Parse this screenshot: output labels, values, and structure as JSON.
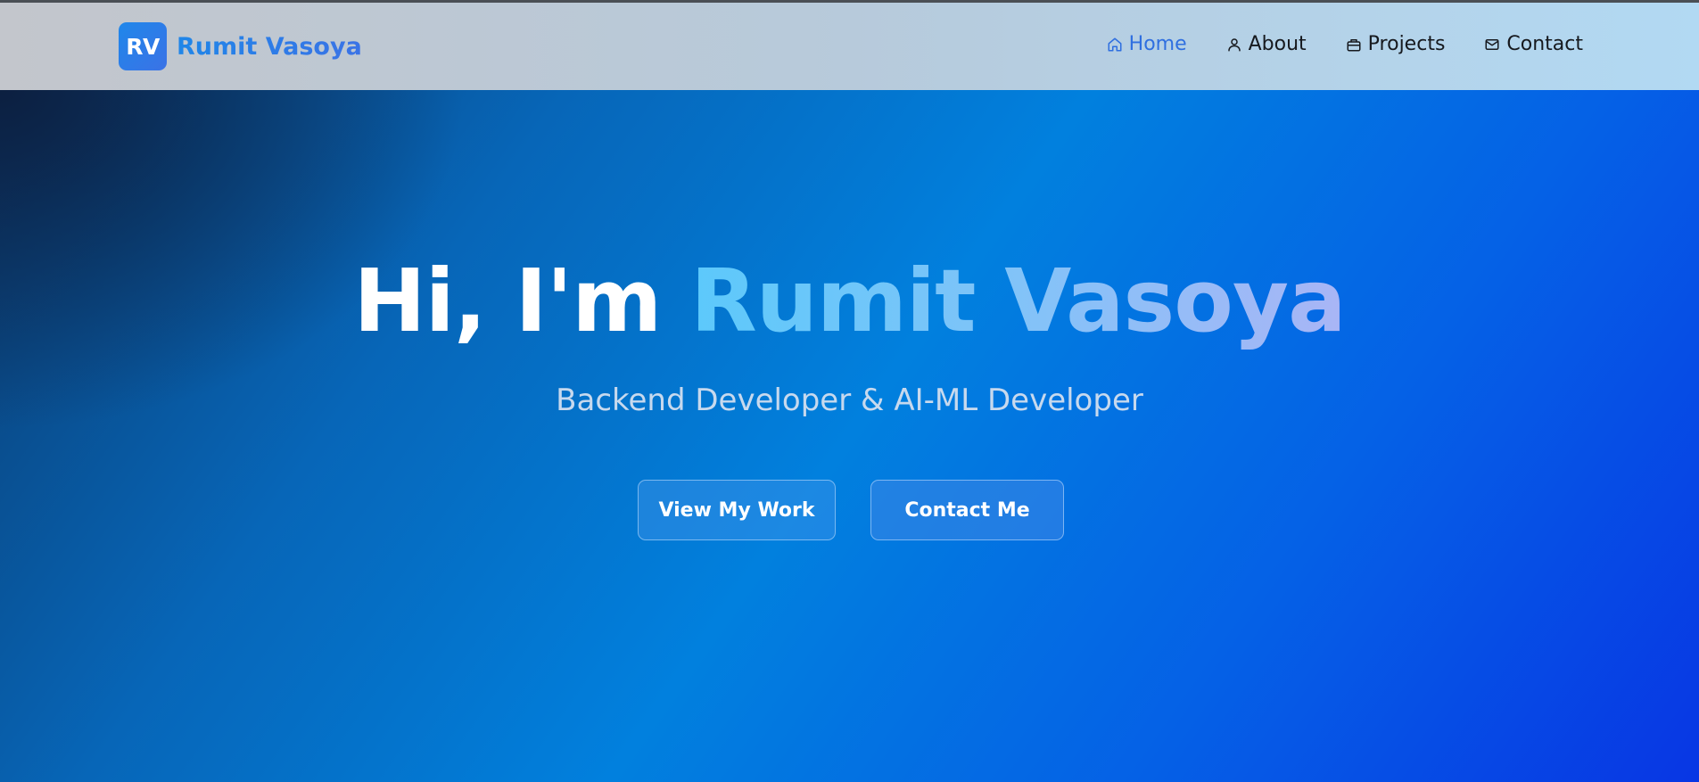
{
  "brand": {
    "logo_text": "RV",
    "name": "Rumit Vasoya"
  },
  "nav": {
    "items": [
      {
        "label": "Home",
        "icon": "home-icon",
        "active": true
      },
      {
        "label": "About",
        "icon": "user-icon",
        "active": false
      },
      {
        "label": "Projects",
        "icon": "briefcase-icon",
        "active": false
      },
      {
        "label": "Contact",
        "icon": "mail-icon",
        "active": false
      }
    ]
  },
  "hero": {
    "greeting": "Hi, I'm",
    "name": "Rumit Vasoya",
    "subtitle": "Backend Developer & AI-ML Developer",
    "buttons": {
      "primary": "View My Work",
      "secondary": "Contact Me"
    }
  },
  "colors": {
    "accent": "#2f6fe0",
    "hero_start": "#0b3c70",
    "hero_mid": "#0180de",
    "hero_end": "#0836e4",
    "name_gradient_start": "#5cc9fb",
    "name_gradient_end": "#a9b5f6"
  }
}
